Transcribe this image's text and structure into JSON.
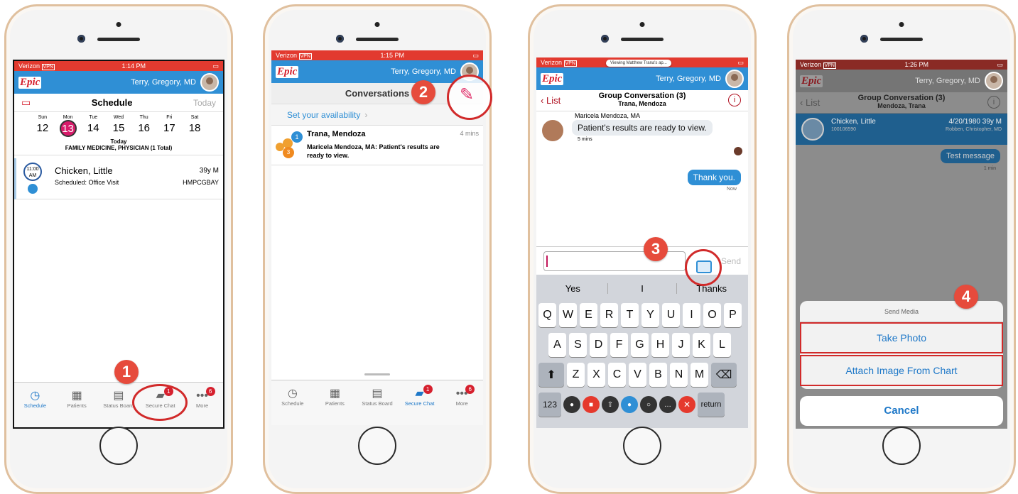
{
  "screens": [
    {
      "status": {
        "carrier": "Verizon",
        "vpn": "VPN",
        "time": "1:14 PM"
      },
      "header": {
        "brand": "Epic",
        "user": "Terry, Gregory, MD"
      },
      "toolbar": {
        "title": "Schedule",
        "right": "Today"
      },
      "week": [
        {
          "day": "Sun",
          "date": "12"
        },
        {
          "day": "Mon",
          "date": "13"
        },
        {
          "day": "Tue",
          "date": "14"
        },
        {
          "day": "Wed",
          "date": "15"
        },
        {
          "day": "Thu",
          "date": "16"
        },
        {
          "day": "Fri",
          "date": "17"
        },
        {
          "day": "Sat",
          "date": "18"
        }
      ],
      "today_label": "Today",
      "dept": "FAMILY MEDICINE, PHYSICIAN (1 Total)",
      "appt": {
        "time": "11:00 AM",
        "patient": "Chicken, Little",
        "age": "39y M",
        "status": "Scheduled: Office Visit",
        "code": "HMPCGBAY"
      },
      "tabs": [
        {
          "label": "Schedule",
          "icon": "clock-icon",
          "active": true
        },
        {
          "label": "Patients",
          "icon": "people-icon"
        },
        {
          "label": "Status Board",
          "icon": "board-icon"
        },
        {
          "label": "Secure Chat",
          "icon": "chat-icon",
          "badge": "1"
        },
        {
          "label": "More",
          "icon": "more-icon",
          "badge": "6"
        }
      ],
      "step": "1"
    },
    {
      "status": {
        "carrier": "Verizon",
        "vpn": "VPN",
        "time": "1:15 PM"
      },
      "header": {
        "brand": "Epic",
        "user": "Terry, Gregory, MD"
      },
      "toolbar": {
        "title": "Conversations"
      },
      "availability": "Set your availability",
      "conversation": {
        "name": "Trana, Mendoza",
        "time": "4 mins",
        "preview": "Maricela Mendoza, MA: Patient's results are ready to view.",
        "unread": "1",
        "members": "3"
      },
      "tabs": [
        {
          "label": "Schedule",
          "icon": "clock-icon"
        },
        {
          "label": "Patients",
          "icon": "people-icon"
        },
        {
          "label": "Status Board",
          "icon": "board-icon"
        },
        {
          "label": "Secure Chat",
          "icon": "chat-icon",
          "badge": "1",
          "active": true
        },
        {
          "label": "More",
          "icon": "more-icon",
          "badge": "6"
        }
      ],
      "step": "2"
    },
    {
      "status": {
        "carrier": "Verizon",
        "vpn": "VPN",
        "banner": "Viewing Matthew Trana's ap..."
      },
      "header": {
        "brand": "Epic",
        "user": "Terry, Gregory, MD"
      },
      "nav": {
        "back": "List",
        "title": "Group Conversation (3)",
        "subtitle": "Trana, Mendoza"
      },
      "messages": [
        {
          "sender": "Maricela Mendoza, MA",
          "text": "Patient's results are ready to view.",
          "time": "5 mins"
        },
        {
          "text": "Thank you.",
          "time": "Now",
          "mine": true
        }
      ],
      "input": {
        "send": "Send"
      },
      "suggestions": [
        "Yes",
        "I",
        "Thanks"
      ],
      "keys": [
        [
          "Q",
          "W",
          "E",
          "R",
          "T",
          "Y",
          "U",
          "I",
          "O",
          "P"
        ],
        [
          "A",
          "S",
          "D",
          "F",
          "G",
          "H",
          "J",
          "K",
          "L"
        ],
        [
          "Z",
          "X",
          "C",
          "V",
          "B",
          "N",
          "M"
        ]
      ],
      "numkey": "123",
      "returnkey": "return",
      "step": "3"
    },
    {
      "status": {
        "carrier": "Verizon",
        "vpn": "VPN",
        "time": "1:26 PM"
      },
      "header": {
        "brand": "Epic",
        "user": "Terry, Gregory, MD"
      },
      "nav": {
        "back": "List",
        "title": "Group Conversation (3)",
        "subtitle": "Mendoza, Trana"
      },
      "patient": {
        "name": "Chicken, Little",
        "mrn": "100106590",
        "dob": "4/20/1980 39y M",
        "provider": "Robben, Christopher, MD"
      },
      "message": {
        "text": "Test message",
        "time": "1 min"
      },
      "sheet": {
        "title": "Send Media",
        "take": "Take Photo",
        "attach": "Attach Image From Chart",
        "cancel": "Cancel"
      },
      "step": "4"
    }
  ]
}
